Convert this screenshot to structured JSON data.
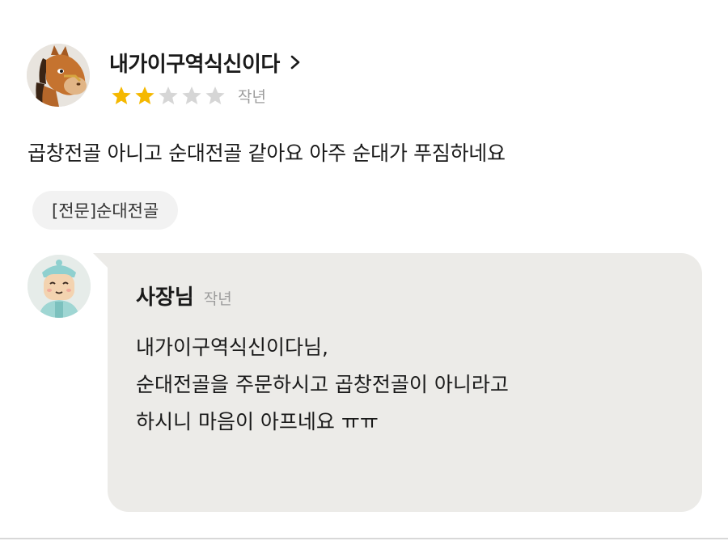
{
  "review": {
    "username": "내가이구역식신이다",
    "username_icon": "chevron-right-icon",
    "rating": 2,
    "rating_max": 5,
    "rating_colors": {
      "filled": "#f5b800",
      "empty": "#d6d6d6"
    },
    "date": "작년",
    "text": "곱창전골 아니고 순대전골 같아요 아주 순대가 푸짐하네요",
    "menu_tag": "[전문]순대전골"
  },
  "reply": {
    "owner_name": "사장님",
    "date": "작년",
    "text": "내가이구역식신이다님,\n순대전골을 주문하시고 곱창전골이 아니라고\n하시니 마음이 아프네요 ㅠㅠ",
    "bubble_color": "#ecebe8"
  }
}
